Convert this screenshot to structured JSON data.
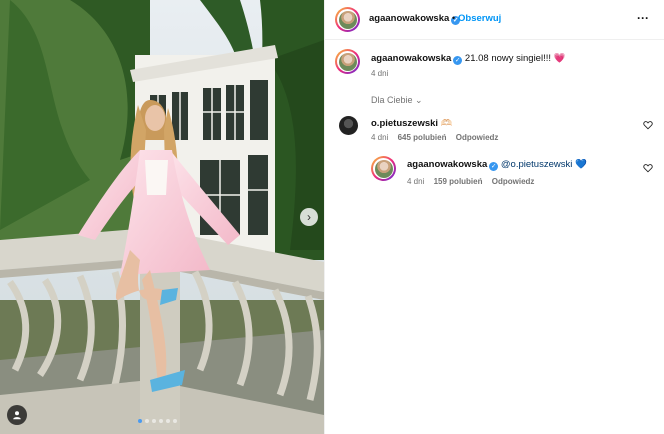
{
  "post": {
    "author": "agaanowakowska",
    "follow_label": "Obserwuj",
    "separator": "•",
    "more_icon": "more-options-icon",
    "caption_text": "21.08 nowy singiel!!! 💗",
    "caption_age": "4 dni",
    "filter_label": "Dla Ciebie",
    "image_count": 6,
    "image_active_index": 0
  },
  "comments": [
    {
      "user": "o.pietuszewski",
      "text": "🫶🏻",
      "age": "4 dni",
      "likes": "645 polubień",
      "reply_label": "Odpowiedz"
    },
    {
      "user": "agaanowakowska",
      "mention": "@o.pietuszewski",
      "text": "💙",
      "age": "4 dni",
      "likes": "159 polubień",
      "reply_label": "Odpowiedz"
    }
  ],
  "colors": {
    "accent": "#0095f6",
    "verified": "#3797f0",
    "muted": "#737373"
  }
}
